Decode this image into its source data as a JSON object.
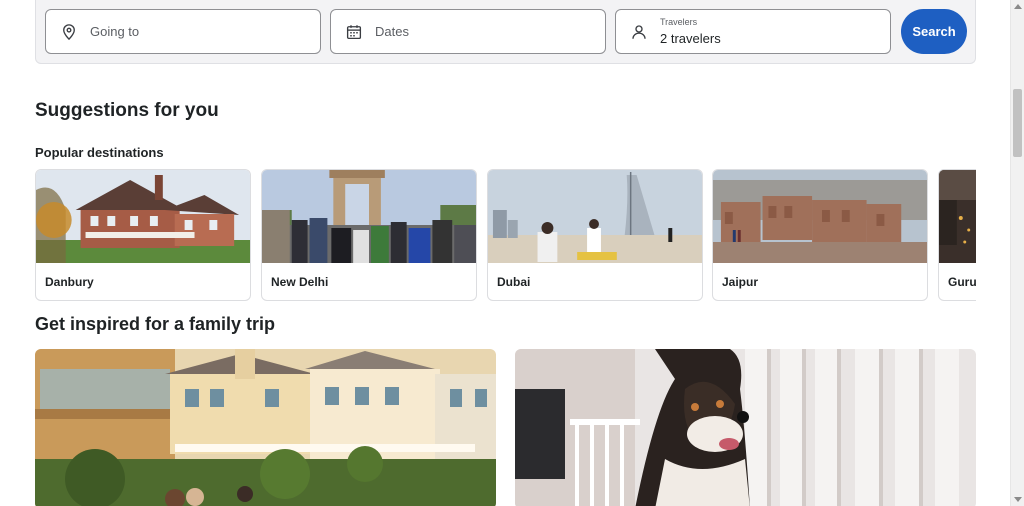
{
  "search": {
    "going_to_placeholder": "Going to",
    "dates_placeholder": "Dates",
    "travelers_label": "Travelers",
    "travelers_value": "2 travelers",
    "search_button": "Search",
    "icons": [
      "location-pin-icon",
      "calendar-icon",
      "person-icon"
    ],
    "accent_color": "#1e5fc2"
  },
  "suggestions": {
    "title": "Suggestions for you",
    "popular_title": "Popular destinations",
    "destinations": [
      {
        "name": "Danbury"
      },
      {
        "name": "New Delhi"
      },
      {
        "name": "Dubai"
      },
      {
        "name": "Jaipur"
      },
      {
        "name": "Guru"
      }
    ]
  },
  "inspiration": {
    "title": "Get inspired for a family trip"
  }
}
